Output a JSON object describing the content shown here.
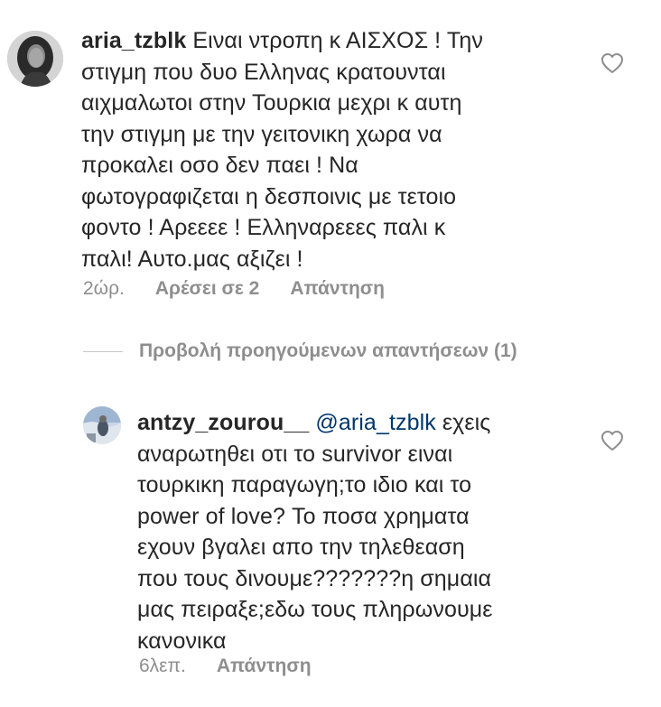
{
  "comments": [
    {
      "username": "aria_tzblk",
      "avatar_icon": "profile-photo-woman",
      "text_lines": [
        "Ειναι ντροπη κ ΑΙΣΧΟΣ ! Την",
        "στιγμη που δυο Ελληνας κρατουνται",
        "αιχμαλωτοι στην Τουρκια μεχρι κ αυτη",
        "την στιγμη με την γειτονικη χωρα να",
        "προκαλει οσο δεν παει ! Να",
        "φωτογραφιζεται η δεσποινις με τετοιο",
        "φοντο ! Αρεεεε ! Ελληναρεεες παλι κ",
        "παλι! Αυτο.μας αξιζει !"
      ],
      "time": "2ώρ.",
      "likes": "Αρέσει σε 2",
      "reply": "Απάντηση"
    }
  ],
  "view_replies": "Προβολή προηγούμενων απαντήσεων (1)",
  "reply_comment": {
    "username": "antzy_zourou__",
    "avatar_icon": "profile-photo-outdoor",
    "mention": "@aria_tzblk",
    "first_line_rest": "εχεις",
    "text_lines": [
      "αναρωτηθει οτι το survivor ειναι",
      "τουρκικη παραγωγη;το ιδιο και το",
      "power of love? Το ποσα χρηματα",
      "εχουν βγαλει απο την τηλεθεαση",
      "που τους δινουμε???????η σημαια",
      "μας πειραξε;εδω τους πληρωνουμε",
      "κανονικα"
    ],
    "time": "6λεπ.",
    "reply": "Απάντηση"
  },
  "icons": {
    "like": "heart-outline-icon"
  },
  "colors": {
    "text": "#262626",
    "secondary": "#8e8e8e",
    "mention": "#00376b",
    "divider": "#c7c7c7",
    "background": "#ffffff"
  }
}
